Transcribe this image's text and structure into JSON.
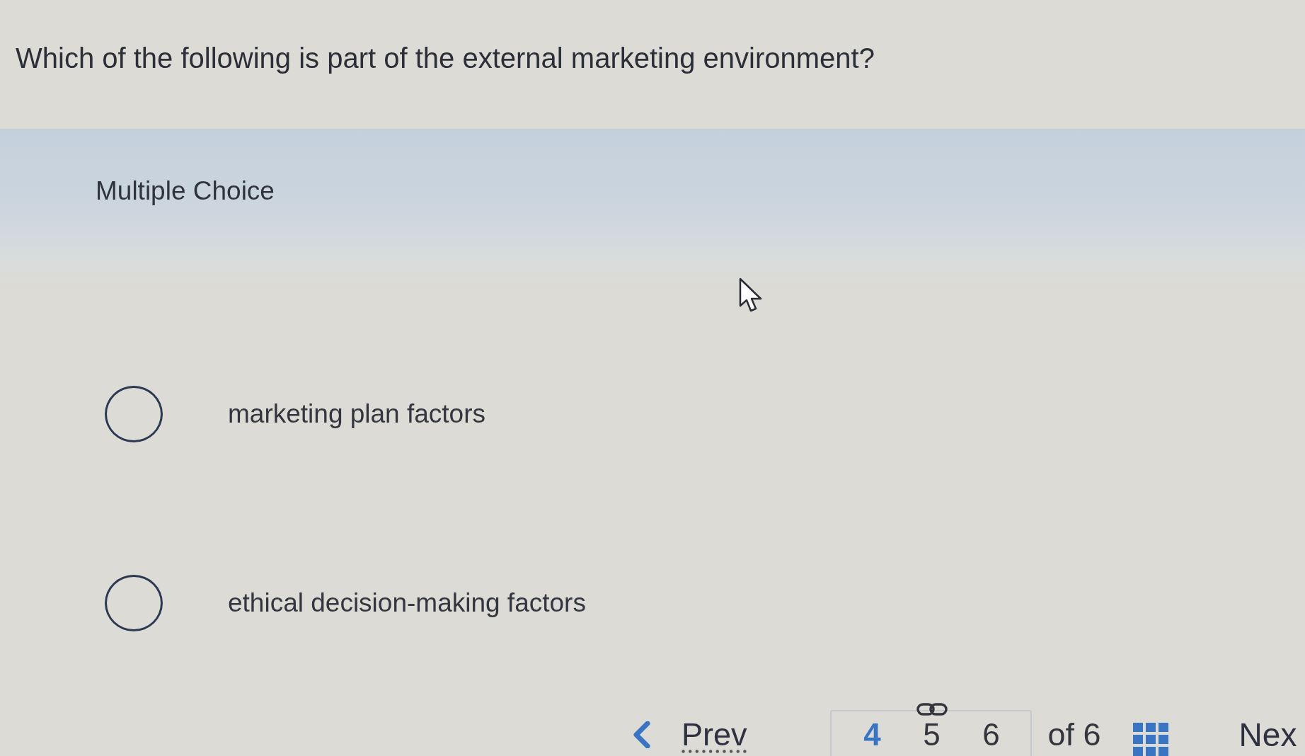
{
  "question": {
    "text": "Which of the following is part of the external marketing environment?"
  },
  "answer_section": {
    "label": "Multiple Choice",
    "options": [
      {
        "text": "marketing plan factors",
        "selected": false
      },
      {
        "text": "ethical decision-making factors",
        "selected": false
      }
    ]
  },
  "pagination": {
    "prev": "Prev",
    "pages": [
      {
        "label": "4",
        "selected": true,
        "linked": false
      },
      {
        "label": "5",
        "selected": false,
        "linked": true
      },
      {
        "label": "6",
        "selected": false,
        "linked": false
      }
    ],
    "total": "of 6",
    "next": "Nex"
  }
}
